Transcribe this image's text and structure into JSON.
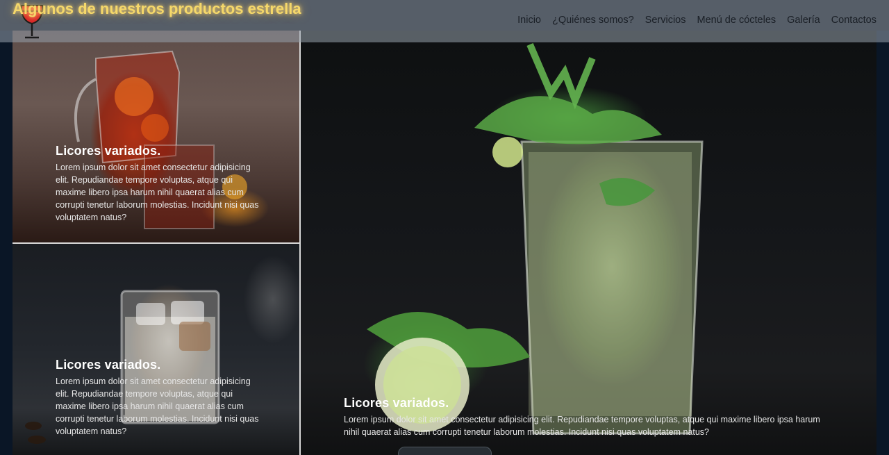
{
  "header": {
    "title": "Algunos de nuestros productos estrella",
    "logo_icon": "wine-glass-icon",
    "nav": [
      {
        "label": "Inicio"
      },
      {
        "label": "¿Quiénes somos?"
      },
      {
        "label": "Servicios"
      },
      {
        "label": "Menú de cócteles"
      },
      {
        "label": "Galería"
      },
      {
        "label": "Contactos"
      }
    ]
  },
  "gallery": {
    "items": [
      {
        "title": "Licores variados.",
        "text": "Lorem ipsum dolor sit amet consectetur adipisicing elit. Repudiandae tempore voluptas, atque qui maxime libero ipsa harum nihil quaerat alias cum corrupti tenetur laborum molestias. Incidunt nisi quas voluptatem natus?"
      },
      {
        "title": "Licores variados.",
        "text": "Lorem ipsum dolor sit amet consectetur adipisicing elit. Repudiandae tempore voluptas, atque qui maxime libero ipsa harum nihil quaerat alias cum corrupti tenetur laborum molestias. Incidunt nisi quas voluptatem natus?"
      },
      {
        "title": "Licores variados.",
        "text": "Lorem ipsum dolor sit amet consectetur adipisicing elit. Repudiandae tempore voluptas, atque qui maxime libero ipsa harum nihil quaerat alias cum corrupti tenetur laborum molestias. Incidunt nisi quas voluptatem natus?"
      }
    ]
  },
  "colors": {
    "title_glow": "#f5d86a",
    "logo_red": "#d8262a",
    "header_overlay": "#96a0ac"
  }
}
